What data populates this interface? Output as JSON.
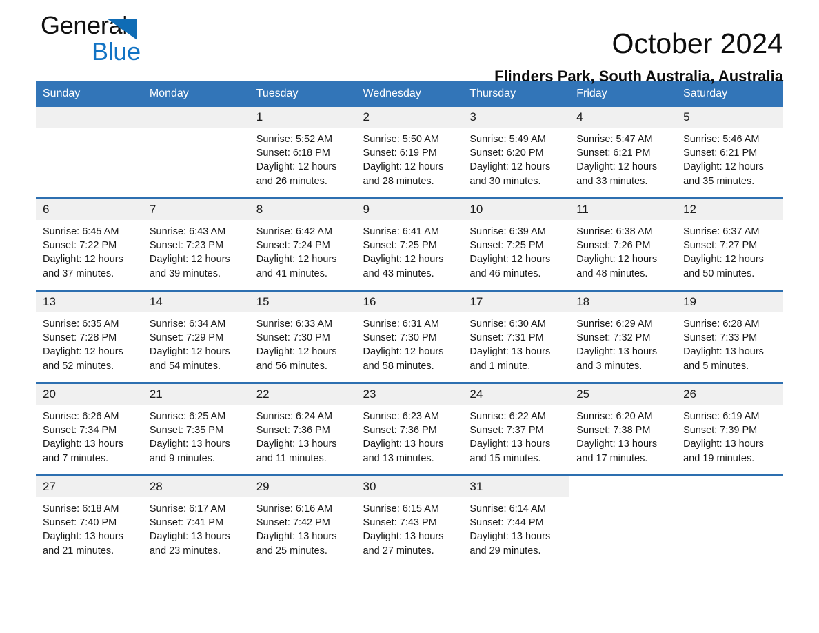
{
  "brand": {
    "name_part1": "General",
    "name_part2": "Blue",
    "triangle_color": "#0f6cb5",
    "blue_color": "#1273c4"
  },
  "header": {
    "title": "October 2024",
    "subtitle": "Flinders Park, South Australia, Australia",
    "accent_color": "#3275b8"
  },
  "calendar": {
    "weekday_headers": [
      "Sunday",
      "Monday",
      "Tuesday",
      "Wednesday",
      "Thursday",
      "Friday",
      "Saturday"
    ],
    "labels": {
      "sunrise": "Sunrise:",
      "sunset": "Sunset:",
      "daylight": "Daylight:"
    },
    "weeks": [
      [
        {
          "day": "",
          "blank": true
        },
        {
          "day": "",
          "blank": true
        },
        {
          "day": "1",
          "sunrise": "Sunrise: 5:52 AM",
          "sunset": "Sunset: 6:18 PM",
          "daylight": "Daylight: 12 hours and 26 minutes."
        },
        {
          "day": "2",
          "sunrise": "Sunrise: 5:50 AM",
          "sunset": "Sunset: 6:19 PM",
          "daylight": "Daylight: 12 hours and 28 minutes."
        },
        {
          "day": "3",
          "sunrise": "Sunrise: 5:49 AM",
          "sunset": "Sunset: 6:20 PM",
          "daylight": "Daylight: 12 hours and 30 minutes."
        },
        {
          "day": "4",
          "sunrise": "Sunrise: 5:47 AM",
          "sunset": "Sunset: 6:21 PM",
          "daylight": "Daylight: 12 hours and 33 minutes."
        },
        {
          "day": "5",
          "sunrise": "Sunrise: 5:46 AM",
          "sunset": "Sunset: 6:21 PM",
          "daylight": "Daylight: 12 hours and 35 minutes."
        }
      ],
      [
        {
          "day": "6",
          "sunrise": "Sunrise: 6:45 AM",
          "sunset": "Sunset: 7:22 PM",
          "daylight": "Daylight: 12 hours and 37 minutes."
        },
        {
          "day": "7",
          "sunrise": "Sunrise: 6:43 AM",
          "sunset": "Sunset: 7:23 PM",
          "daylight": "Daylight: 12 hours and 39 minutes."
        },
        {
          "day": "8",
          "sunrise": "Sunrise: 6:42 AM",
          "sunset": "Sunset: 7:24 PM",
          "daylight": "Daylight: 12 hours and 41 minutes."
        },
        {
          "day": "9",
          "sunrise": "Sunrise: 6:41 AM",
          "sunset": "Sunset: 7:25 PM",
          "daylight": "Daylight: 12 hours and 43 minutes."
        },
        {
          "day": "10",
          "sunrise": "Sunrise: 6:39 AM",
          "sunset": "Sunset: 7:25 PM",
          "daylight": "Daylight: 12 hours and 46 minutes."
        },
        {
          "day": "11",
          "sunrise": "Sunrise: 6:38 AM",
          "sunset": "Sunset: 7:26 PM",
          "daylight": "Daylight: 12 hours and 48 minutes."
        },
        {
          "day": "12",
          "sunrise": "Sunrise: 6:37 AM",
          "sunset": "Sunset: 7:27 PM",
          "daylight": "Daylight: 12 hours and 50 minutes."
        }
      ],
      [
        {
          "day": "13",
          "sunrise": "Sunrise: 6:35 AM",
          "sunset": "Sunset: 7:28 PM",
          "daylight": "Daylight: 12 hours and 52 minutes."
        },
        {
          "day": "14",
          "sunrise": "Sunrise: 6:34 AM",
          "sunset": "Sunset: 7:29 PM",
          "daylight": "Daylight: 12 hours and 54 minutes."
        },
        {
          "day": "15",
          "sunrise": "Sunrise: 6:33 AM",
          "sunset": "Sunset: 7:30 PM",
          "daylight": "Daylight: 12 hours and 56 minutes."
        },
        {
          "day": "16",
          "sunrise": "Sunrise: 6:31 AM",
          "sunset": "Sunset: 7:30 PM",
          "daylight": "Daylight: 12 hours and 58 minutes."
        },
        {
          "day": "17",
          "sunrise": "Sunrise: 6:30 AM",
          "sunset": "Sunset: 7:31 PM",
          "daylight": "Daylight: 13 hours and 1 minute."
        },
        {
          "day": "18",
          "sunrise": "Sunrise: 6:29 AM",
          "sunset": "Sunset: 7:32 PM",
          "daylight": "Daylight: 13 hours and 3 minutes."
        },
        {
          "day": "19",
          "sunrise": "Sunrise: 6:28 AM",
          "sunset": "Sunset: 7:33 PM",
          "daylight": "Daylight: 13 hours and 5 minutes."
        }
      ],
      [
        {
          "day": "20",
          "sunrise": "Sunrise: 6:26 AM",
          "sunset": "Sunset: 7:34 PM",
          "daylight": "Daylight: 13 hours and 7 minutes."
        },
        {
          "day": "21",
          "sunrise": "Sunrise: 6:25 AM",
          "sunset": "Sunset: 7:35 PM",
          "daylight": "Daylight: 13 hours and 9 minutes."
        },
        {
          "day": "22",
          "sunrise": "Sunrise: 6:24 AM",
          "sunset": "Sunset: 7:36 PM",
          "daylight": "Daylight: 13 hours and 11 minutes."
        },
        {
          "day": "23",
          "sunrise": "Sunrise: 6:23 AM",
          "sunset": "Sunset: 7:36 PM",
          "daylight": "Daylight: 13 hours and 13 minutes."
        },
        {
          "day": "24",
          "sunrise": "Sunrise: 6:22 AM",
          "sunset": "Sunset: 7:37 PM",
          "daylight": "Daylight: 13 hours and 15 minutes."
        },
        {
          "day": "25",
          "sunrise": "Sunrise: 6:20 AM",
          "sunset": "Sunset: 7:38 PM",
          "daylight": "Daylight: 13 hours and 17 minutes."
        },
        {
          "day": "26",
          "sunrise": "Sunrise: 6:19 AM",
          "sunset": "Sunset: 7:39 PM",
          "daylight": "Daylight: 13 hours and 19 minutes."
        }
      ],
      [
        {
          "day": "27",
          "sunrise": "Sunrise: 6:18 AM",
          "sunset": "Sunset: 7:40 PM",
          "daylight": "Daylight: 13 hours and 21 minutes."
        },
        {
          "day": "28",
          "sunrise": "Sunrise: 6:17 AM",
          "sunset": "Sunset: 7:41 PM",
          "daylight": "Daylight: 13 hours and 23 minutes."
        },
        {
          "day": "29",
          "sunrise": "Sunrise: 6:16 AM",
          "sunset": "Sunset: 7:42 PM",
          "daylight": "Daylight: 13 hours and 25 minutes."
        },
        {
          "day": "30",
          "sunrise": "Sunrise: 6:15 AM",
          "sunset": "Sunset: 7:43 PM",
          "daylight": "Daylight: 13 hours and 27 minutes."
        },
        {
          "day": "31",
          "sunrise": "Sunrise: 6:14 AM",
          "sunset": "Sunset: 7:44 PM",
          "daylight": "Daylight: 13 hours and 29 minutes."
        },
        {
          "day": "",
          "blank": true,
          "trailing": true
        },
        {
          "day": "",
          "blank": true,
          "trailing": true
        }
      ]
    ]
  }
}
